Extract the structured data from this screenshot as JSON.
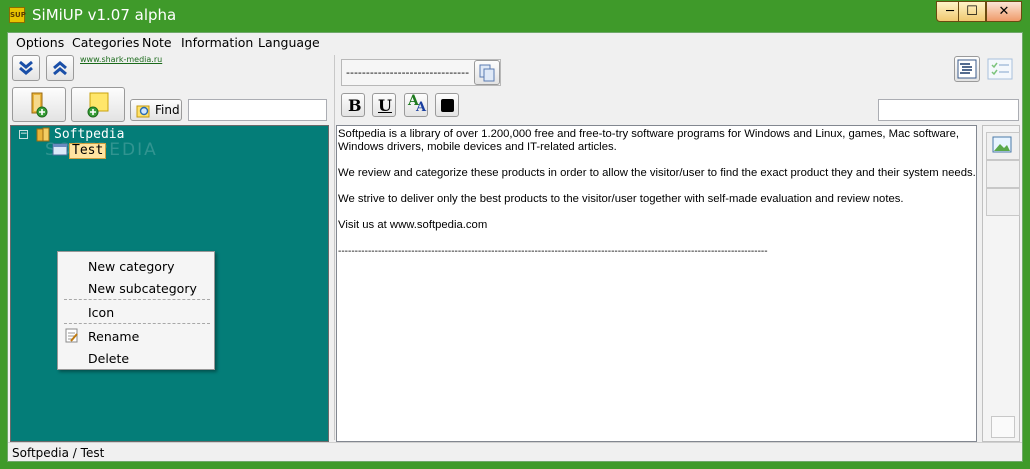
{
  "window": {
    "title": "SiMiUP v1.07 alpha",
    "icon_text": "SUP",
    "minimize_glyph": "─",
    "maximize_glyph": "☐",
    "close_glyph": "✕"
  },
  "menu": [
    "Options",
    "Categories",
    "Note",
    "Information",
    "Language"
  ],
  "toolbar": {
    "site_link": "www.shark-media.ru",
    "find_label": "Find",
    "find_value": "",
    "combo_value": "-------------------------------",
    "right_search_value": ""
  },
  "format_buttons": {
    "bold": "B",
    "underline": "U",
    "font": "A"
  },
  "tree": {
    "root": "Softpedia",
    "child": "Test",
    "expander": "−",
    "watermark": "SOFTPEDIA"
  },
  "context_menu": [
    "New category",
    "New subcategory",
    "Icon",
    "Rename",
    "Delete"
  ],
  "editor": {
    "paragraphs": [
      "Softpedia is a library of over 1.200,000 free and free-to-try software programs for Windows and Linux, games, Mac software,",
      "Windows drivers, mobile devices and IT-related articles.",
      "We review and categorize these products in order to allow the visitor/user to find the exact product they and their system needs.",
      "We strive to deliver only the best products to the visitor/user together with self-made evaluation and review notes.",
      "Visit us at www.softpedia.com",
      "---------------------------------------------------------------------------------------------------------------------------------"
    ]
  },
  "status": {
    "path": "Softpedia / Test"
  },
  "colors": {
    "titlebar": "#3f9a2a",
    "tree_background": "#047d78",
    "selected_node": "#ffe4a0"
  },
  "icons": [
    "expand-down-icon",
    "collapse-up-icon",
    "add-folder-icon",
    "add-note-icon",
    "find-icon",
    "copy-icon",
    "bold-icon",
    "underline-icon",
    "font-icon",
    "color-icon",
    "list-view-icon",
    "check-list-icon",
    "folder-icon",
    "image-icon",
    "rename-icon"
  ]
}
